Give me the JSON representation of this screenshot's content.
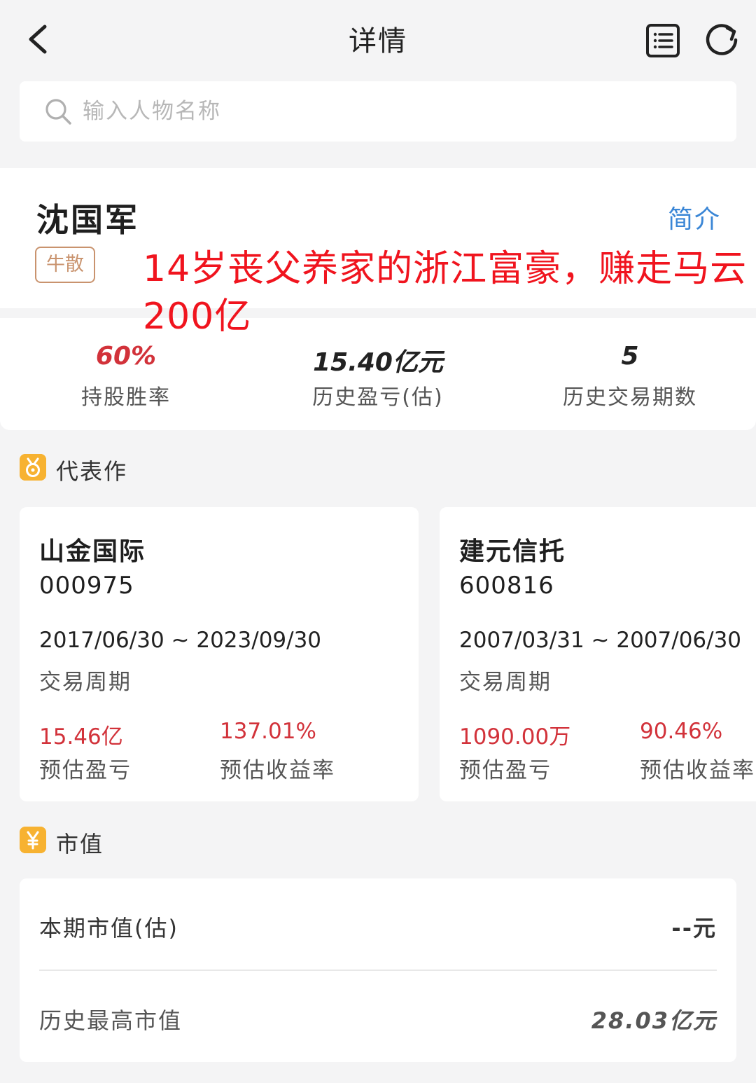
{
  "header": {
    "title": "详情",
    "back_icon": "back-arrow-icon",
    "list_icon": "list-icon",
    "refresh_icon": "refresh-icon"
  },
  "search": {
    "placeholder": "输入人物名称",
    "value": ""
  },
  "profile": {
    "name": "沈国军",
    "intro_link": "简介",
    "tag": "牛散"
  },
  "overlay_caption": "14岁丧父养家的浙江富豪，赚走马云200亿",
  "stats": [
    {
      "value": "60%",
      "label": "持股胜率",
      "color": "#d2323a"
    },
    {
      "value": "15.40亿元",
      "label": "历史盈亏(估)",
      "color": "#222222"
    },
    {
      "value": "5",
      "label": "历史交易期数",
      "color": "#222222"
    }
  ],
  "works_section": {
    "title": "代表作",
    "icon": "medal-icon"
  },
  "works": [
    {
      "name": "山金国际",
      "code": "000975",
      "period": "2017/06/30 ~ 2023/09/30",
      "period_label": "交易周期",
      "pnl": "15.46亿",
      "pnl_label": "预估盈亏",
      "return": "137.01%",
      "return_label": "预估收益率"
    },
    {
      "name": "建元信托",
      "code": "600816",
      "period": "2007/03/31 ~ 2007/06/30",
      "period_label": "交易周期",
      "pnl": "1090.00万",
      "pnl_label": "预估盈亏",
      "return": "90.46%",
      "return_label": "预估收益率"
    }
  ],
  "market_section": {
    "title": "市值",
    "icon": "yen-icon"
  },
  "market": {
    "current_label": "本期市值(估)",
    "current_value": "--元",
    "max_label": "历史最高市值",
    "max_value": "28.03亿元"
  }
}
